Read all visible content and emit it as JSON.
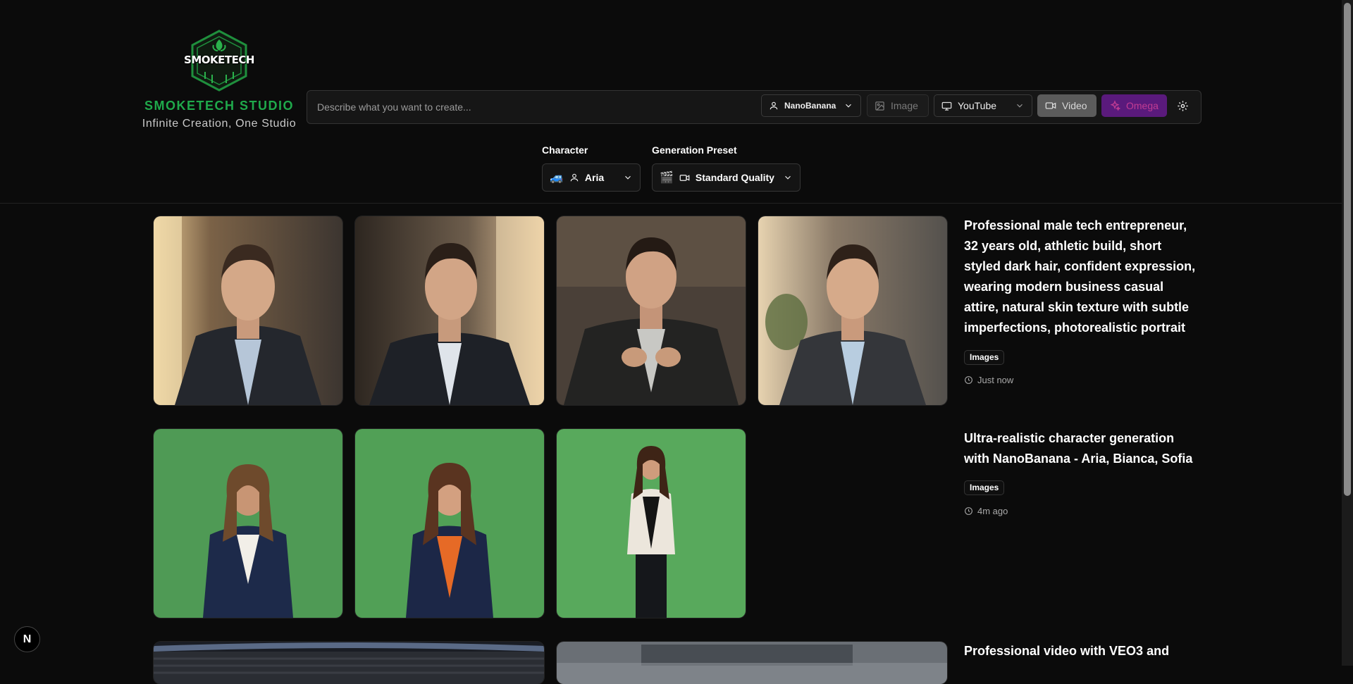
{
  "brand": {
    "logo_text": "SMOKETECH",
    "title": "SMOKETECH STUDIO",
    "subtitle": "Infinite Creation, One Studio",
    "accent": "#1fa94b"
  },
  "prompt": {
    "placeholder": "Describe what you want to create...",
    "value": ""
  },
  "toolbar": {
    "model_label": "NanoBanana",
    "image_label": "Image",
    "platform_label": "YouTube",
    "video_label": "Video",
    "omega_label": "Omega"
  },
  "character": {
    "label": "Character",
    "value": "Aria",
    "emoji": "🚙"
  },
  "preset": {
    "label": "Generation Preset",
    "value": "Standard Quality",
    "emoji": "🎬"
  },
  "feed": [
    {
      "title": "Professional male tech entrepreneur, 32 years old, athletic build, short styled dark hair, confident expression, wearing modern business casual attire, natural skin texture with subtle imperfections, photorealistic portrait",
      "tag": "Images",
      "time": "Just now",
      "images": [
        "man-portrait-window-light",
        "man-portrait-office-sunlight",
        "man-portrait-seated-dark",
        "man-portrait-office-plants"
      ]
    },
    {
      "title": "Ultra-realistic character generation with NanoBanana - Aria, Bianca, Sofia",
      "tag": "Images",
      "time": "4m ago",
      "images": [
        "woman-navy-blazer-greenscreen",
        "woman-orange-top-greenscreen",
        "woman-white-blazer-greenscreen"
      ]
    },
    {
      "title": "Professional video with VEO3 and",
      "images": [
        "carbon-car-video",
        "blurred-road-video"
      ]
    }
  ],
  "dev_badge": "N"
}
